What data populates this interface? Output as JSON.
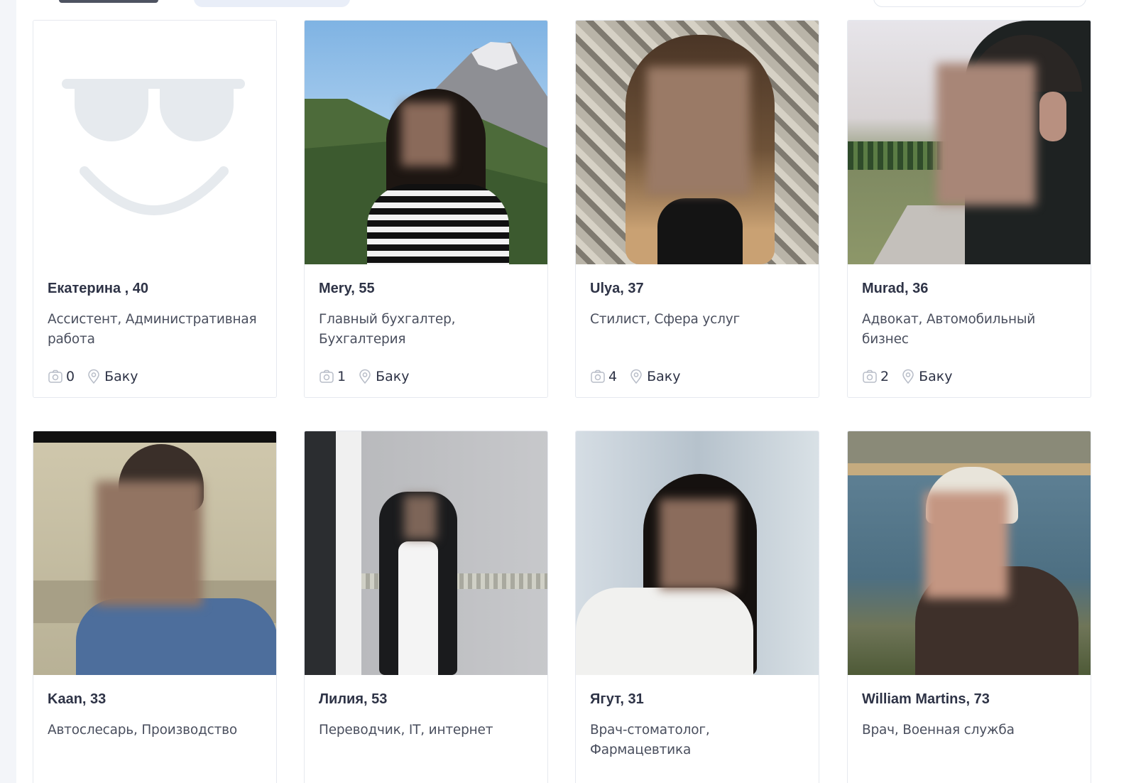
{
  "accent": "#2e3346",
  "placeholder_color": "#e6eaee",
  "cards": [
    {
      "name": "Екатерина , 40",
      "job": "Ассистент, Административная работа",
      "photos": "0",
      "city": "Баку"
    },
    {
      "name": "Mery, 55",
      "job": "Главный бухгалтер, Бухгалтерия",
      "photos": "1",
      "city": "Баку"
    },
    {
      "name": "Ulya, 37",
      "job": "Стилист, Сфера услуг",
      "photos": "4",
      "city": "Баку"
    },
    {
      "name": "Murad, 36",
      "job": "Адвокат, Автомобильный бизнес",
      "photos": "2",
      "city": "Баку"
    },
    {
      "name": "Kaan, 33",
      "job": "Автослесарь, Производство"
    },
    {
      "name": "Лилия, 53",
      "job": "Переводчик, IT, интернет"
    },
    {
      "name": "Ягут, 31",
      "job": "Врач-стоматолог, Фармацевтика"
    },
    {
      "name": "William Martins, 73",
      "job": "Врач, Военная служба"
    }
  ],
  "icons": {
    "photos": "camera-icon",
    "city": "location-pin-icon",
    "placeholder": "smiley-placeholder-icon"
  }
}
